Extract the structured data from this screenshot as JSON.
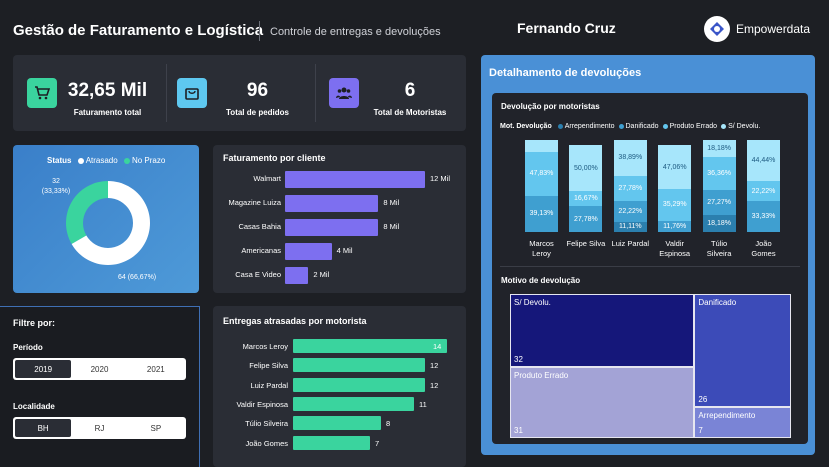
{
  "header": {
    "title": "Gestão de Faturamento e Logística",
    "subtitle": "Controle de entregas e devoluções",
    "user": "Fernando Cruz",
    "brand": "Empowerdata"
  },
  "kpis": [
    {
      "value": "32,65 Mil",
      "label": "Faturamento total",
      "icon": "cart-icon",
      "color": "#3ad49e"
    },
    {
      "value": "96",
      "label": "Total de pedidos",
      "icon": "shopping-bag-icon",
      "color": "#5ec8f0"
    },
    {
      "value": "6",
      "label": "Total de Motoristas",
      "icon": "people-icon",
      "color": "#7d6ff0"
    }
  ],
  "status_chart": {
    "legend_title": "Status",
    "legend": [
      "Atrasado",
      "No Prazo"
    ],
    "label_atrasado_line1": "32",
    "label_atrasado_line2": "(33,33%)",
    "label_noprazo": "64 (66,67%)"
  },
  "faturamento": {
    "title": "Faturamento por cliente",
    "items": [
      {
        "label": "Walmart",
        "value_label": "12 Mil"
      },
      {
        "label": "Magazine Luiza",
        "value_label": "8 Mil"
      },
      {
        "label": "Casas Bahia",
        "value_label": "8 Mil"
      },
      {
        "label": "Americanas",
        "value_label": "4 Mil"
      },
      {
        "label": "Casa E Video",
        "value_label": "2 Mil"
      }
    ]
  },
  "entregas": {
    "title": "Entregas atrasadas por motorista",
    "items": [
      {
        "label": "Marcos Leroy",
        "value_label": "14"
      },
      {
        "label": "Felipe Silva",
        "value_label": "12"
      },
      {
        "label": "Luiz Pardal",
        "value_label": "12"
      },
      {
        "label": "Valdir Espinosa",
        "value_label": "11"
      },
      {
        "label": "Túlio Silveira",
        "value_label": "8"
      },
      {
        "label": "João Gomes",
        "value_label": "7"
      }
    ]
  },
  "filters": {
    "title": "Filtre por:",
    "periodo_label": "Período",
    "periodo_options": [
      "2019",
      "2020",
      "2021"
    ],
    "periodo_selected": "2019",
    "localidade_label": "Localidade",
    "localidade_options": [
      "BH",
      "RJ",
      "SP"
    ],
    "localidade_selected": "BH"
  },
  "devolucoes": {
    "panel_title": "Detalhamento de devoluções",
    "stack_title": "Devolução por motoristas",
    "legend_title": "Mot. Devolução",
    "legend": [
      {
        "name": "Arrependimento",
        "color": "#2b7fae"
      },
      {
        "name": "Danificado",
        "color": "#3f9fd0"
      },
      {
        "name": "Produto Errado",
        "color": "#63c6ee"
      },
      {
        "name": "S/ Devolu.",
        "color": "#a7e6fb"
      }
    ],
    "treemap_title": "Motivo de devolução",
    "treemap": [
      {
        "label": "S/ Devolu.",
        "value": "32",
        "color": "#15177a"
      },
      {
        "label": "Produto Errado",
        "value": "31",
        "color": "#a3a3d6"
      },
      {
        "label": "Danificado",
        "value": "26",
        "color": "#3c4bb8"
      },
      {
        "label": "Arrependimento",
        "value": "7",
        "color": "#7a84d6"
      }
    ]
  },
  "chart_data": [
    {
      "type": "pie",
      "title": "Status",
      "categories": [
        "Atrasado",
        "No Prazo"
      ],
      "values": [
        32,
        64
      ],
      "percent_labels": [
        "33,33%",
        "66,67%"
      ],
      "colors": [
        "#3ad49e",
        "#ffffff"
      ]
    },
    {
      "type": "bar",
      "title": "Faturamento por cliente",
      "orientation": "horizontal",
      "categories": [
        "Walmart",
        "Magazine Luiza",
        "Casas Bahia",
        "Americanas",
        "Casa E Video"
      ],
      "values": [
        12,
        8,
        8,
        4,
        2
      ],
      "unit": "Mil",
      "color": "#7d6ff0"
    },
    {
      "type": "bar",
      "title": "Entregas atrasadas por motorista",
      "orientation": "horizontal",
      "categories": [
        "Marcos Leroy",
        "Felipe Silva",
        "Luiz Pardal",
        "Valdir Espinosa",
        "Túlio Silveira",
        "João Gomes"
      ],
      "values": [
        14,
        12,
        12,
        11,
        8,
        7
      ],
      "color": "#3ad49e"
    },
    {
      "type": "bar",
      "stacked": "percent",
      "title": "Devolução por motoristas",
      "categories": [
        "Marcos Leroy",
        "Felipe Silva",
        "Luiz Pardal",
        "Valdir Espinosa",
        "Túlio Silveira",
        "João Gomes"
      ],
      "series": [
        {
          "name": "Arrependimento",
          "values": [
            0,
            0,
            11.11,
            0,
            18.18,
            0
          ],
          "labels": [
            "",
            "",
            "11,11%",
            "",
            "18,18%",
            ""
          ]
        },
        {
          "name": "Danificado",
          "values": [
            39.13,
            27.78,
            22.22,
            11.76,
            27.27,
            33.33
          ],
          "labels": [
            "39,13%",
            "27,78%",
            "22,22%",
            "11,76%",
            "27,27%",
            "33,33%"
          ]
        },
        {
          "name": "Produto Errado",
          "values": [
            47.83,
            16.67,
            27.78,
            35.29,
            36.36,
            22.22
          ],
          "labels": [
            "47,83%",
            "16,67%",
            "27,78%",
            "35,29%",
            "36,36%",
            "22,22%"
          ]
        },
        {
          "name": "S/ Devolu.",
          "values": [
            13.04,
            50.0,
            38.89,
            47.06,
            18.18,
            44.44
          ],
          "labels": [
            "",
            "50,00%",
            "38,89%",
            "47,06%",
            "18,18%",
            "44,44%"
          ]
        }
      ],
      "x_labels": [
        [
          "Marcos",
          "Leroy"
        ],
        [
          "Felipe Silva"
        ],
        [
          "Luiz Pardal"
        ],
        [
          "Valdir",
          "Espinosa"
        ],
        [
          "Túlio",
          "Silveira"
        ],
        [
          "João",
          "Gomes"
        ]
      ]
    },
    {
      "type": "treemap",
      "title": "Motivo de devolução",
      "categories": [
        "S/ Devolu.",
        "Produto Errado",
        "Danificado",
        "Arrependimento"
      ],
      "values": [
        32,
        31,
        26,
        7
      ]
    }
  ]
}
